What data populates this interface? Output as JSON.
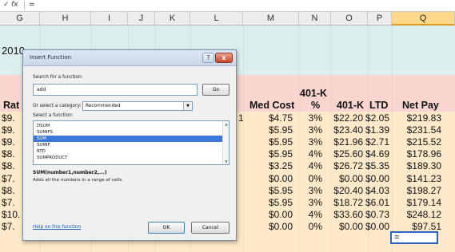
{
  "formula_bar": {
    "check_icon": "✓",
    "fx_label": "fx",
    "content": "="
  },
  "columns": [
    "G",
    "H",
    "I",
    "J",
    "K",
    "L",
    "M",
    "N",
    "O",
    "P",
    "Q"
  ],
  "sheet": {
    "year_fragment": "2010",
    "row_label_fragment": "Rat",
    "headers": {
      "med_cost": "Med Cost",
      "k401_top": "401-K",
      "k401_pct": "%",
      "k401": "401-K",
      "ltd": "LTD",
      "net_pay": "Net Pay"
    },
    "stray_value": "1",
    "rows": [
      {
        "rate": "$9.",
        "med": "$4.75",
        "pct": "3%",
        "k": "$22.20",
        "ltd": "$2.05",
        "net": "$219.83"
      },
      {
        "rate": "$9.",
        "med": "$5.95",
        "pct": "3%",
        "k": "$23.40",
        "ltd": "$1.39",
        "net": "$231.54"
      },
      {
        "rate": "$9.",
        "med": "$5.95",
        "pct": "3%",
        "k": "$21.96",
        "ltd": "$2.71",
        "net": "$215.52"
      },
      {
        "rate": "$8.",
        "med": "$5.95",
        "pct": "4%",
        "k": "$25.60",
        "ltd": "$4.69",
        "net": "$178.96"
      },
      {
        "rate": "$8.",
        "med": "$3.25",
        "pct": "4%",
        "k": "$26.72",
        "ltd": "$5.35",
        "net": "$189.30"
      },
      {
        "rate": "$7.",
        "med": "$0.00",
        "pct": "0%",
        "k": "$0.00",
        "ltd": "$0.00",
        "net": "$141.23"
      },
      {
        "rate": "$8.",
        "med": "$5.95",
        "pct": "3%",
        "k": "$20.40",
        "ltd": "$4.03",
        "net": "$198.27"
      },
      {
        "rate": "$7.",
        "med": "$5.95",
        "pct": "3%",
        "k": "$18.72",
        "ltd": "$6.01",
        "net": "$179.14"
      },
      {
        "rate": "$10.",
        "med": "$0.00",
        "pct": "4%",
        "k": "$33.60",
        "ltd": "$0.73",
        "net": "$248.12"
      },
      {
        "rate": "$7.",
        "med": "$0.00",
        "pct": "0%",
        "k": "$0.00",
        "ltd": "$0.00",
        "net": "$97.51"
      }
    ],
    "active_cell_value": "="
  },
  "dialog": {
    "title": "Insert Function",
    "help_glyph": "?",
    "close_glyph": "x",
    "search_label": "Search for a function:",
    "search_value": "add",
    "go_label": "Go",
    "category_label": "Or select a category:",
    "category_value": "Recommended",
    "combo_arrow": "▼",
    "function_label": "Select a function:",
    "functions": [
      "DSUM",
      "SUMIFS",
      "SUM",
      "SUMIF",
      "RTD",
      "SUMPRODUCT"
    ],
    "selected_index": 2,
    "scroll_up": "▲",
    "scroll_down": "▼",
    "signature": "SUM(number1,number2,...)",
    "description": "Adds all the numbers in a range of cells.",
    "help_link": "Help on this function",
    "ok_label": "OK",
    "cancel_label": "Cancel"
  },
  "colors": {
    "band_top": "#dcefed",
    "band_header": "#f8d6cf",
    "band_body": "#fde9c9",
    "selected_column": "#ffd88a",
    "selection_blue": "#3b78d8"
  }
}
